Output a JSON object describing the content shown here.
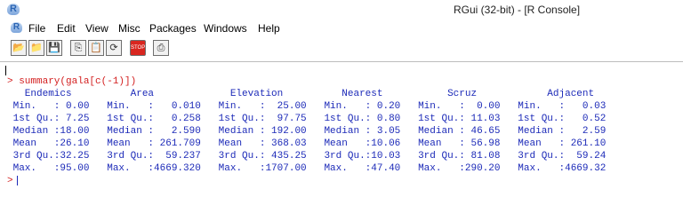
{
  "window": {
    "app_icon_letter": "R",
    "title": "RGui (32-bit) - [R Console]"
  },
  "menubar": {
    "icon_letter": "R",
    "items": [
      {
        "label": "File"
      },
      {
        "label": "Edit"
      },
      {
        "label": "View"
      },
      {
        "label": "Misc"
      },
      {
        "label": "Packages"
      },
      {
        "label": "Windows"
      },
      {
        "label": "Help"
      }
    ]
  },
  "toolbar": {
    "buttons": [
      {
        "name": "open-script",
        "glyph": "📂"
      },
      {
        "name": "load-workspace",
        "glyph": "📁"
      },
      {
        "name": "save",
        "glyph": "💾"
      },
      {
        "name": "copy",
        "glyph": "⎘"
      },
      {
        "name": "paste",
        "glyph": "📋"
      },
      {
        "name": "copy-paste",
        "glyph": "⟳"
      },
      {
        "name": "stop",
        "glyph": "STOP"
      },
      {
        "name": "print",
        "glyph": "⎙"
      }
    ]
  },
  "console": {
    "command": "> summary(gala[c(-1)])",
    "output_lines": [
      "   Endemics          Area             Elevation          Nearest           Scruz            Adjacent     ",
      " Min.   : 0.00   Min.   :   0.010   Min.   :  25.00   Min.   : 0.20   Min.   :  0.00   Min.   :   0.03  ",
      " 1st Qu.: 7.25   1st Qu.:   0.258   1st Qu.:  97.75   1st Qu.: 0.80   1st Qu.: 11.03   1st Qu.:   0.52  ",
      " Median :18.00   Median :   2.590   Median : 192.00   Median : 3.05   Median : 46.65   Median :   2.59  ",
      " Mean   :26.10   Mean   : 261.709   Mean   : 368.03   Mean   :10.06   Mean   : 56.98   Mean   : 261.10  ",
      " 3rd Qu.:32.25   3rd Qu.:  59.237   3rd Qu.: 435.25   3rd Qu.:10.03   3rd Qu.: 81.08   3rd Qu.:  59.24  ",
      " Max.   :95.00   Max.   :4669.320   Max.   :1707.00   Max.   :47.40   Max.   :290.20   Max.   :4669.32  "
    ],
    "prompt": ">"
  }
}
